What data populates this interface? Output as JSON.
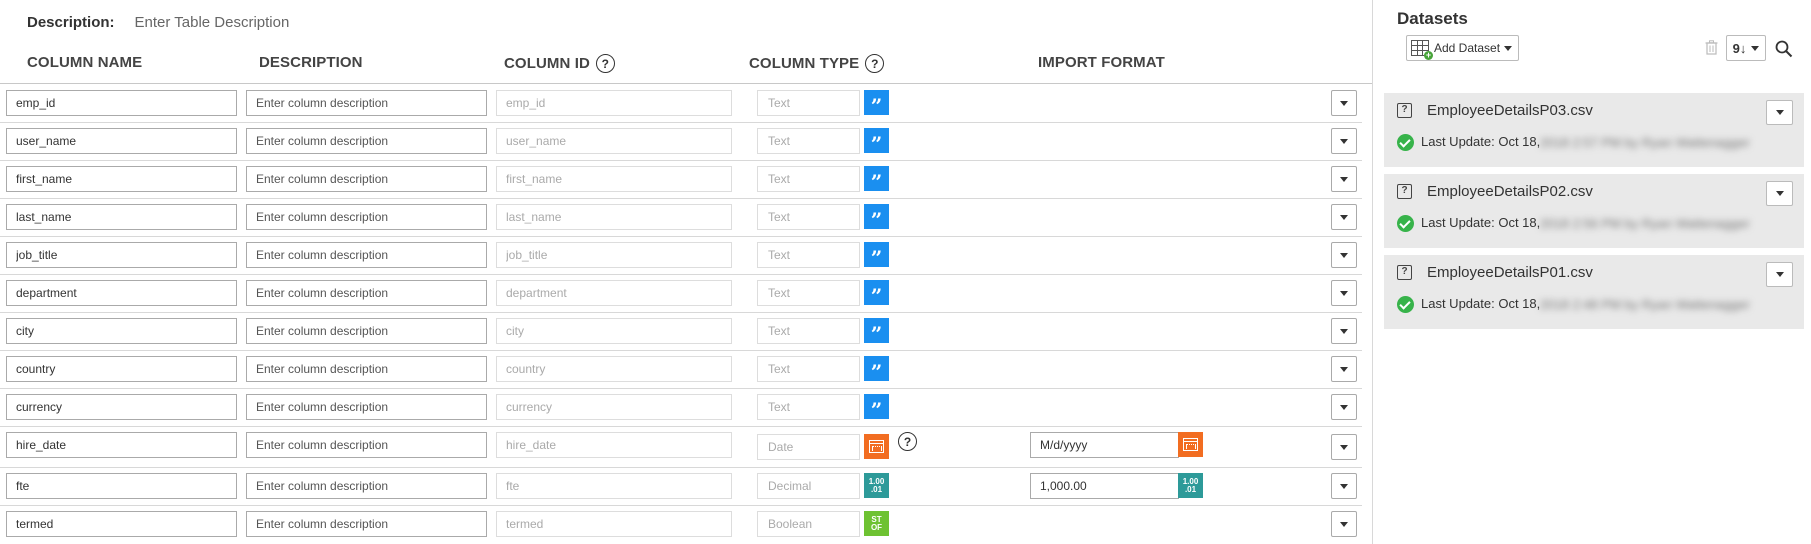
{
  "table": {
    "description_label": "Description:",
    "description_placeholder": "Enter Table Description"
  },
  "columns_header": {
    "name": "COLUMN NAME",
    "description": "DESCRIPTION",
    "column_id": "COLUMN ID",
    "column_type": "COLUMN TYPE",
    "import_format": "IMPORT FORMAT",
    "help_glyph": "?"
  },
  "type_glyphs": {
    "text": "”",
    "decimal_top": "1.00",
    "decimal_bottom": ".01",
    "boolean_top": "ST",
    "boolean_bottom": "OF"
  },
  "rows": [
    {
      "name": "emp_id",
      "desc_placeholder": "Enter column description",
      "col_id": "emp_id",
      "type": "Text"
    },
    {
      "name": "user_name",
      "desc_placeholder": "Enter column description",
      "col_id": "user_name",
      "type": "Text"
    },
    {
      "name": "first_name",
      "desc_placeholder": "Enter column description",
      "col_id": "first_name",
      "type": "Text"
    },
    {
      "name": "last_name",
      "desc_placeholder": "Enter column description",
      "col_id": "last_name",
      "type": "Text"
    },
    {
      "name": "job_title",
      "desc_placeholder": "Enter column description",
      "col_id": "job_title",
      "type": "Text"
    },
    {
      "name": "department",
      "desc_placeholder": "Enter column description",
      "col_id": "department",
      "type": "Text"
    },
    {
      "name": "city",
      "desc_placeholder": "Enter column description",
      "col_id": "city",
      "type": "Text"
    },
    {
      "name": "country",
      "desc_placeholder": "Enter column description",
      "col_id": "country",
      "type": "Text"
    },
    {
      "name": "currency",
      "desc_placeholder": "Enter column description",
      "col_id": "currency",
      "type": "Text"
    },
    {
      "name": "hire_date",
      "desc_placeholder": "Enter column description",
      "col_id": "hire_date",
      "type": "Date",
      "import_format": "M/d/yyyy"
    },
    {
      "name": "fte",
      "desc_placeholder": "Enter column description",
      "col_id": "fte",
      "type": "Decimal",
      "import_format": "1,000.00"
    },
    {
      "name": "termed",
      "desc_placeholder": "Enter column description",
      "col_id": "termed",
      "type": "Boolean"
    }
  ],
  "datasets": {
    "title": "Datasets",
    "add_button": "Add Dataset",
    "sort_label": "9↓",
    "items": [
      {
        "name": "EmployeeDetailsP03.csv",
        "update": "Last Update: Oct 18,",
        "redacted": "2018 2:57 PM by Ryan Wattenagger"
      },
      {
        "name": "EmployeeDetailsP02.csv",
        "update": "Last Update: Oct 18,",
        "redacted": "2018 2:56 PM by Ryan Wattenagger"
      },
      {
        "name": "EmployeeDetailsP01.csv",
        "update": "Last Update: Oct 18,",
        "redacted": "2018 2:48 PM by Ryan Wattenagger"
      }
    ]
  },
  "colors": {
    "text_type": "#1a8ff0",
    "date_type": "#f26d21",
    "decimal_type": "#2d9a99",
    "boolean_type": "#6ec232",
    "success": "#37b34a"
  }
}
